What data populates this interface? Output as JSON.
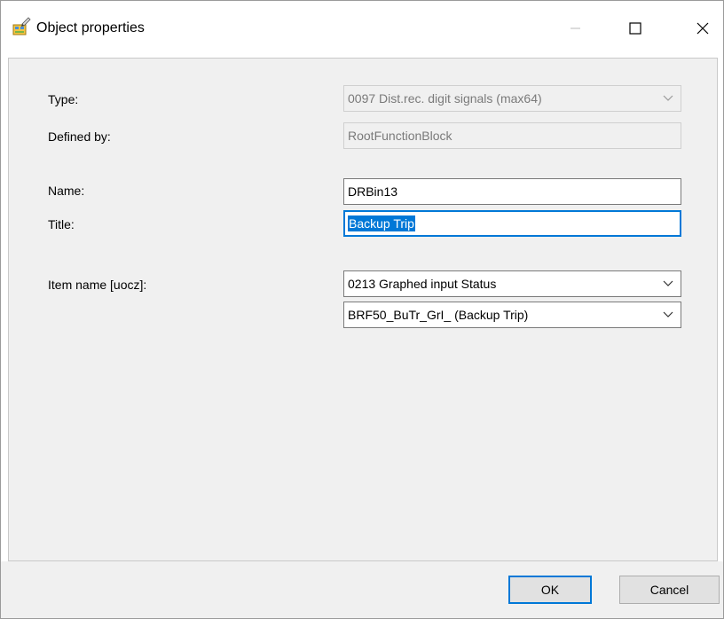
{
  "window": {
    "title": "Object properties",
    "icon": "object-properties-icon"
  },
  "titlebar_buttons": {
    "minimize": "minimize-icon",
    "maximize": "maximize-icon",
    "close": "close-icon"
  },
  "form": {
    "type_label": "Type:",
    "type_value": "0097  Dist.rec. digit signals (max64)",
    "defined_by_label": "Defined by:",
    "defined_by_value": "RootFunctionBlock",
    "name_label": "Name:",
    "name_value": "DRBin13",
    "title_label": "Title:",
    "title_value": "Backup Trip",
    "item_name_label": "Item name [uocz]:",
    "item_name_value": "0213  Graphed input Status",
    "signal_value": "BRF50_BuTr_GrI_ (Backup Trip)"
  },
  "buttons": {
    "ok": "OK",
    "cancel": "Cancel"
  },
  "colors": {
    "accent": "#0078d7",
    "dialog_bg": "#f0f0f0",
    "disabled_text": "#7a7a7a"
  }
}
